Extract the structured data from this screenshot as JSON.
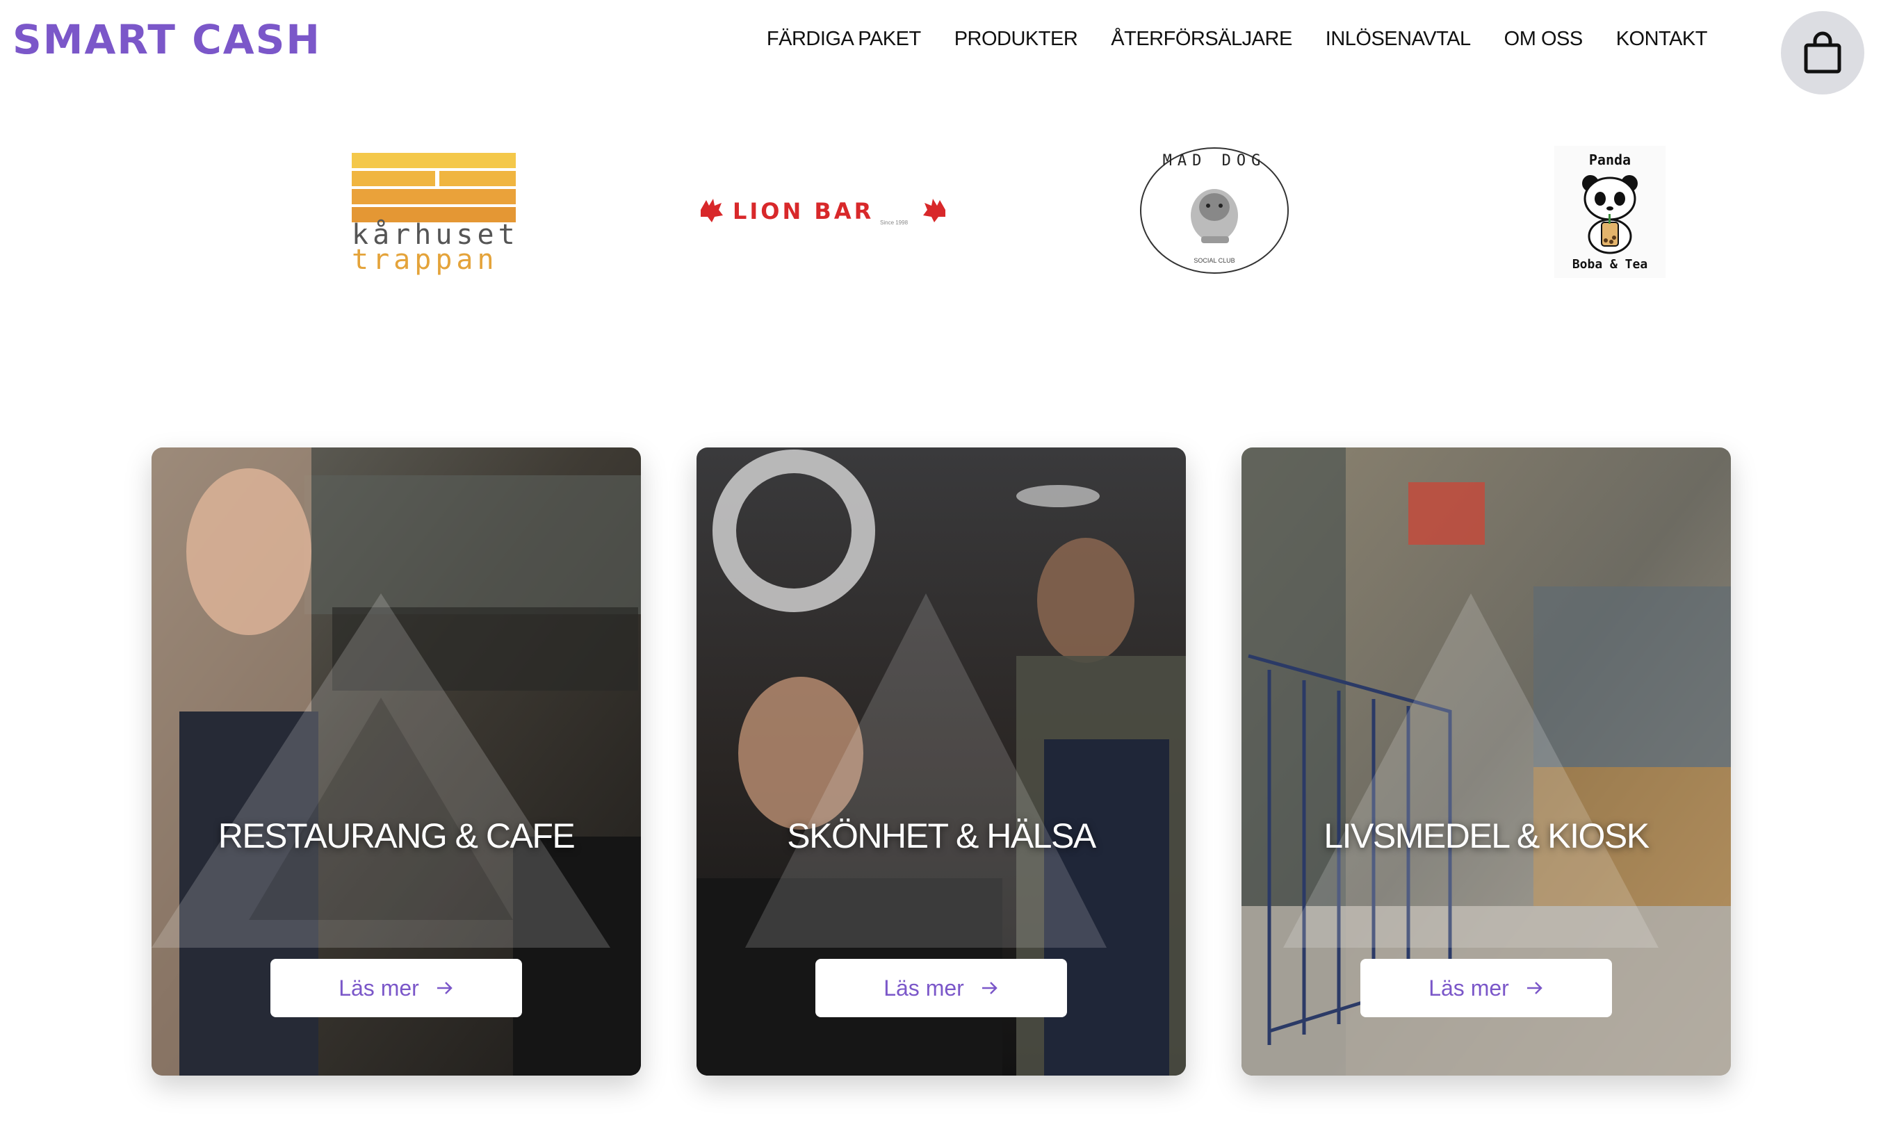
{
  "colors": {
    "brand": "#7b57c9",
    "nav_text": "#111111",
    "cart_bg": "#dcdde2",
    "button_text": "#7b57c9"
  },
  "header": {
    "brand": "SMART CASH",
    "nav": [
      {
        "label": "FÄRDIGA PAKET"
      },
      {
        "label": "PRODUKTER"
      },
      {
        "label": "ÅTERFÖRSÄLJARE"
      },
      {
        "label": "INLÖSENAVTAL"
      },
      {
        "label": "OM OSS"
      },
      {
        "label": "KONTAKT"
      }
    ],
    "cart_icon": "shopping-bag-icon"
  },
  "partner_logos": {
    "karhuset": {
      "line1": "kårhuset",
      "line2": "trappan"
    },
    "lionbar": {
      "name": "LION BAR",
      "tagline": "Since 1998"
    },
    "maddog": {
      "name": "MAD DOG",
      "subtitle": "SOCIAL CLUB"
    },
    "panda": {
      "top": "Panda",
      "bottom": "Boba & Tea"
    }
  },
  "cards": [
    {
      "title": "RESTAURANG & CAFE",
      "button": "Läs mer",
      "button_icon": "arrow-right-icon"
    },
    {
      "title": "SKÖNHET & HÄLSA",
      "button": "Läs mer",
      "button_icon": "arrow-right-icon"
    },
    {
      "title": "LIVSMEDEL & KIOSK",
      "button": "Läs mer",
      "button_icon": "arrow-right-icon"
    }
  ]
}
